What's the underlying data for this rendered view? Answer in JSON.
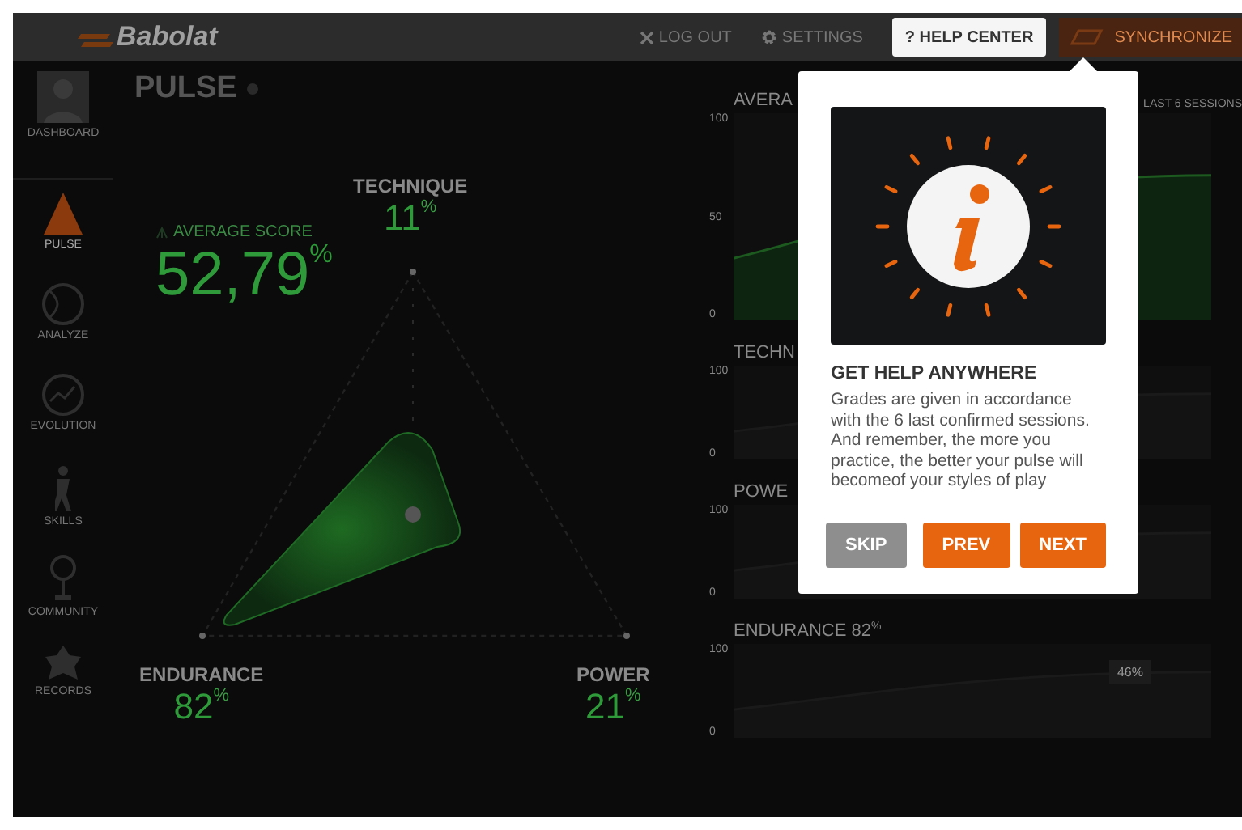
{
  "header": {
    "logo": "Babolat",
    "links": [
      {
        "kind": "close",
        "label": "LOG OUT"
      },
      {
        "kind": "gear",
        "label": "SETTINGS"
      }
    ],
    "help_button": {
      "icon": "?",
      "label": "HELP CENTER"
    },
    "sync_button": "SYNCHRONIZE"
  },
  "sidebar": {
    "items": [
      {
        "label": "DASHBOARD",
        "kind": "avatar",
        "selected": false
      },
      {
        "label": "PULSE",
        "kind": "triangle",
        "selected": true
      },
      {
        "label": "ANALYZE",
        "kind": "ball",
        "selected": false
      },
      {
        "label": "EVOLUTION",
        "kind": "dial",
        "selected": false
      },
      {
        "label": "SKILLS",
        "kind": "player",
        "selected": false
      },
      {
        "label": "COMMUNITY",
        "kind": "trophy",
        "selected": false
      },
      {
        "label": "RECORDS",
        "kind": "badge",
        "selected": false
      }
    ]
  },
  "pulse": {
    "title": "PULSE",
    "average_score": {
      "label": "AVERAGE SCORE",
      "value": "52,79",
      "unit": "%"
    },
    "axes": [
      {
        "label": "TECHNIQUE",
        "value": "11",
        "unit": "%"
      },
      {
        "label": "ENDURANCE",
        "value": "82",
        "unit": "%"
      },
      {
        "label": "POWER",
        "value": "21",
        "unit": "%"
      }
    ]
  },
  "charts": [
    {
      "title": "AVERA",
      "subtitle": "LAST 6 SESSIONS",
      "yticks": [
        "100",
        "50",
        "0"
      ]
    },
    {
      "title": "TECHN",
      "yticks": [
        "100",
        "0"
      ]
    },
    {
      "title": "POWE",
      "yticks": [
        "100",
        "0"
      ]
    },
    {
      "title": "ENDURANCE",
      "value": "82",
      "unit": "%",
      "yticks": [
        "100",
        "0"
      ],
      "tooltip": "46%"
    }
  ],
  "help": {
    "title": "GET HELP ANYWHERE",
    "text": "Grades are given in accordance with the 6 last confirmed sessions. And remember, the more you practice, the better your pulse will becomeof your styles of play",
    "buttons": [
      {
        "label": "SKIP",
        "kind": "secondary"
      },
      {
        "label": "PREV",
        "kind": "primary"
      },
      {
        "label": "NEXT",
        "kind": "primary"
      }
    ]
  }
}
